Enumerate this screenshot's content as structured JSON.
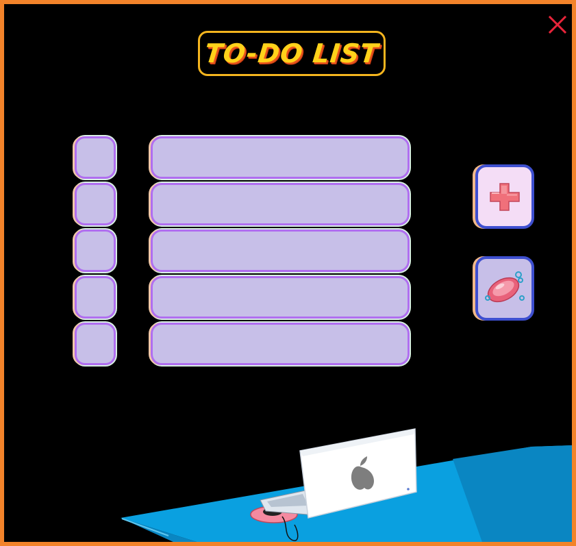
{
  "window": {
    "title": "TO-DO LIST"
  },
  "tasks": [
    {
      "value": "",
      "placeholder": ""
    },
    {
      "value": "",
      "placeholder": ""
    },
    {
      "value": "",
      "placeholder": ""
    },
    {
      "value": "",
      "placeholder": ""
    },
    {
      "value": "",
      "placeholder": ""
    }
  ],
  "buttons": {
    "close_icon": "close-icon",
    "add_icon": "plus-icon",
    "clear_icon": "soap-icon"
  },
  "colors": {
    "frame": "#f2832a",
    "title": "#ffd21a",
    "field_fill": "#c7bfe8",
    "field_border": "#b06ef0",
    "button_border": "#3e4fcf",
    "close": "#e8243a"
  }
}
